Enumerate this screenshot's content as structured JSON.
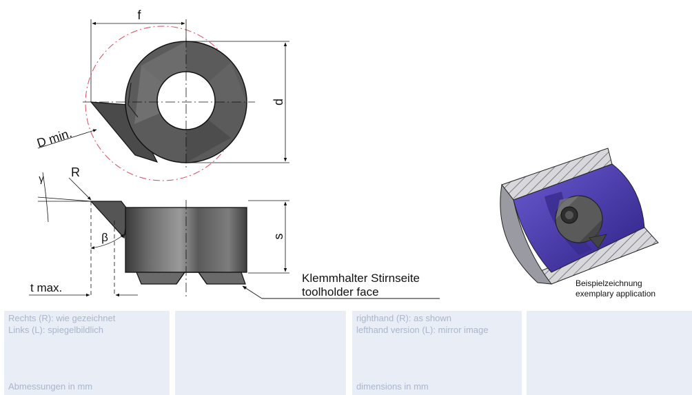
{
  "drawing": {
    "dim_f": "f",
    "dim_d": "d",
    "dim_d_min": "D min.",
    "dim_r": "R",
    "dim_gamma": "γ",
    "dim_beta": "β",
    "dim_s": "s",
    "dim_t_max": "t max.",
    "toolholder_de": "Klemmhalter Stirnseite",
    "toolholder_en": "toolholder face",
    "example_de": "Beispielzeichnung",
    "example_en": "exemplary application"
  },
  "footer": {
    "de_line1": "Rechts (R): wie gezeichnet",
    "de_line2": "Links (L): spiegelbildlich",
    "de_units": "Abmessungen in mm",
    "en_line1": "righthand (R): as shown",
    "en_line2": "lefthand version (L): mirror image",
    "en_units": "dimensions in mm"
  },
  "colors": {
    "insert_gray": "#5b5b5b",
    "insert_dark": "#3c3c3c",
    "insert_light": "#8a8a8a",
    "red_circle": "#d9485a",
    "purple": "#4b3aa6",
    "footer_bg": "#e9edf5",
    "footer_text": "#aab6cc"
  }
}
